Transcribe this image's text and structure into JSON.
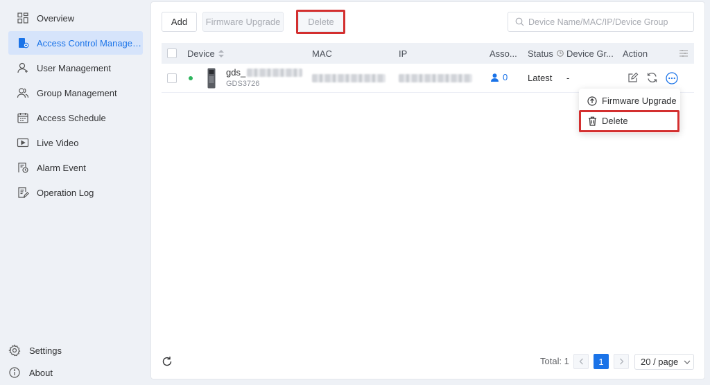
{
  "sidebar": {
    "items": [
      {
        "label": "Overview",
        "icon": "dashboard-icon"
      },
      {
        "label": "Access Control Management",
        "icon": "access-control-icon",
        "active": true
      },
      {
        "label": "User Management",
        "icon": "user-icon"
      },
      {
        "label": "Group Management",
        "icon": "group-icon"
      },
      {
        "label": "Access Schedule",
        "icon": "calendar-icon"
      },
      {
        "label": "Live Video",
        "icon": "video-icon"
      },
      {
        "label": "Alarm Event",
        "icon": "alarm-event-icon"
      },
      {
        "label": "Operation Log",
        "icon": "log-icon"
      }
    ],
    "bottom": [
      {
        "label": "Settings",
        "icon": "gear-icon"
      },
      {
        "label": "About",
        "icon": "info-icon"
      }
    ]
  },
  "toolbar": {
    "add_label": "Add",
    "firmware_upgrade_label": "Firmware Upgrade",
    "delete_label": "Delete"
  },
  "search": {
    "placeholder": "Device Name/MAC/IP/Device Group",
    "value": ""
  },
  "table": {
    "columns": [
      "Device",
      "MAC",
      "IP",
      "Asso...",
      "Status",
      "Device Gr...",
      "Action"
    ],
    "rows": [
      {
        "status_dot_color": "#2db55d",
        "device_name": "gds_",
        "device_model": "GDS3726",
        "associated_count": "0",
        "status": "Latest",
        "device_group": "-"
      }
    ]
  },
  "action_menu": {
    "items": [
      {
        "label": "Firmware Upgrade",
        "icon": "upload-icon"
      },
      {
        "label": "Delete",
        "icon": "trash-icon"
      }
    ]
  },
  "pagination": {
    "total_label": "Total: 1",
    "current_page": "1",
    "page_size": "20 / page"
  },
  "colors": {
    "accent": "#1a73e8",
    "highlight": "#d32f2f",
    "online": "#2db55d"
  }
}
